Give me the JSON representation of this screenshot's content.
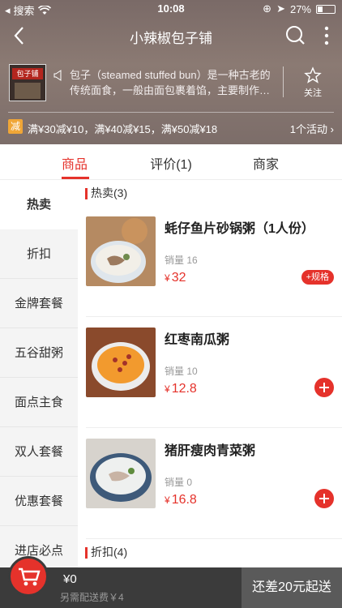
{
  "status": {
    "carrier": "搜索",
    "time": "10:08",
    "battery": "27%"
  },
  "nav": {
    "title": "小辣椒包子铺"
  },
  "shop": {
    "sign": "包子铺",
    "desc_line1": "包子（steamed stuffed bun）是一种古老的",
    "desc_line2": "传统面食，一般由面包裹着馅，主要制作材…",
    "follow_label": "关注"
  },
  "promo": {
    "badge": "减",
    "text": "满¥30减¥10，满¥40减¥15，满¥50减¥18",
    "count": "1个活动",
    "badge_color": "#f0a637"
  },
  "tabs": [
    {
      "label": "商品"
    },
    {
      "label": "评价(1)"
    },
    {
      "label": "商家"
    }
  ],
  "categories": [
    {
      "label": "热卖"
    },
    {
      "label": "折扣"
    },
    {
      "label": "金牌套餐"
    },
    {
      "label": "五谷甜粥"
    },
    {
      "label": "面点主食"
    },
    {
      "label": "双人套餐"
    },
    {
      "label": "优惠套餐"
    },
    {
      "label": "进店必点"
    }
  ],
  "sections": [
    {
      "title": "热卖(3)"
    },
    {
      "title": "折扣(4)"
    }
  ],
  "items": [
    {
      "name": "蚝仔鱼片砂锅粥（1人份）",
      "sales": "销量 16",
      "currency": "¥",
      "price": "32",
      "spec": "+规格"
    },
    {
      "name": "红枣南瓜粥",
      "sales": "销量 10",
      "currency": "¥",
      "price": "12.8"
    },
    {
      "name": "猪肝瘦肉青菜粥",
      "sales": "销量 0",
      "currency": "¥",
      "price": "16.8"
    }
  ],
  "cart": {
    "total": "¥0",
    "delivery": "另需配送费￥4",
    "checkout": "还差20元起送"
  },
  "colors": {
    "accent": "#e5322b"
  }
}
